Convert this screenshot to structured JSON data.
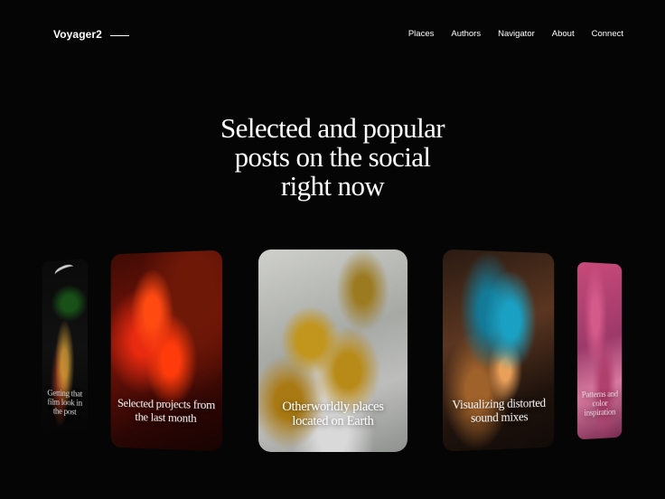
{
  "brand": {
    "name": "Voyager2"
  },
  "nav": {
    "items": [
      "Places",
      "Authors",
      "Navigator",
      "About",
      "Connect"
    ]
  },
  "hero": {
    "lines": [
      "Selected and popular",
      "posts on the social",
      "right now"
    ]
  },
  "cards": [
    {
      "caption": [
        "Getting that film look in",
        "the post"
      ]
    },
    {
      "caption": [
        "Selected projects from",
        "the last month"
      ]
    },
    {
      "caption": [
        "Otherworldly places",
        "located on Earth"
      ]
    },
    {
      "caption": [
        "Visualizing distorted",
        "sound mixes"
      ]
    },
    {
      "caption": [
        "Patterns and color",
        "inspiration"
      ]
    }
  ]
}
